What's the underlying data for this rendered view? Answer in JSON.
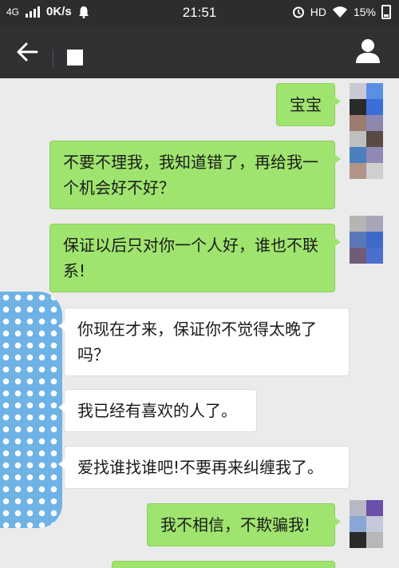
{
  "status_bar": {
    "network": "4G",
    "speed": "0K/s",
    "time": "21:51",
    "hd": "HD",
    "battery": "15%"
  },
  "header": {
    "back_icon": "back-arrow-icon",
    "contact_icon": "person-icon"
  },
  "messages": [
    {
      "side": "out",
      "text": "宝宝"
    },
    {
      "side": "out",
      "text": "不要不理我，我知道错了，再给我一个机会好不好？"
    },
    {
      "side": "out",
      "text": "保证以后只对你一个人好，谁也不联系!"
    },
    {
      "side": "in",
      "text": "你现在才来，保证你不觉得太晚了吗？"
    },
    {
      "side": "in",
      "text": "我已经有喜欢的人了。"
    },
    {
      "side": "in",
      "text": "爱找谁找谁吧!不要再来纠缠我了。"
    },
    {
      "side": "out",
      "text": "我不相信，不欺骗我!"
    }
  ],
  "colors": {
    "status_bg": "#2b2d2f",
    "header_bg": "#2f3133",
    "chat_bg": "#ebebeb",
    "outgoing_bubble": "#9fe46e",
    "incoming_bubble": "#ffffff"
  }
}
